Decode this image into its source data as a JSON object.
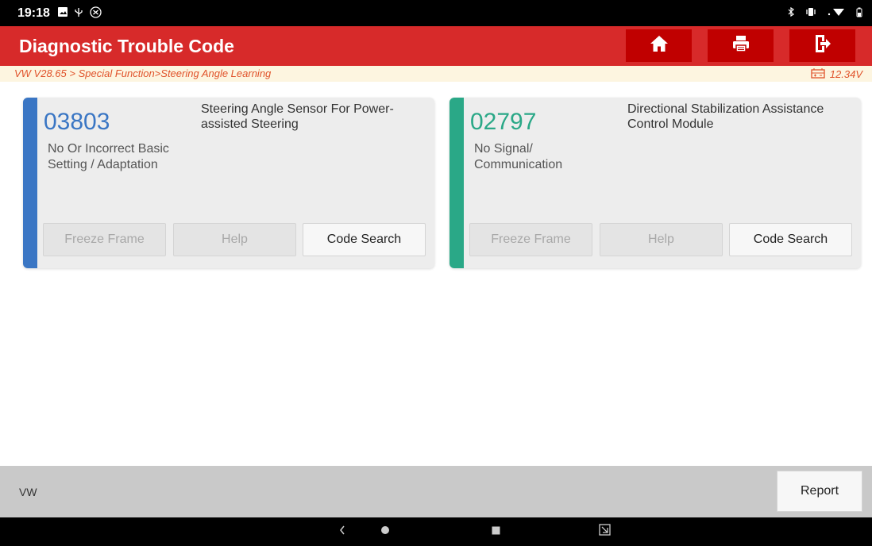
{
  "status_bar": {
    "time": "19:18",
    "left_icons": [
      "image-icon",
      "usb-icon",
      "accessibility-icon"
    ],
    "right_icons": [
      "bluetooth-icon",
      "vibrate-icon",
      "wifi-icon",
      "battery-icon"
    ]
  },
  "header": {
    "title": "Diagnostic Trouble Code",
    "buttons": [
      "home-icon",
      "print-icon",
      "exit-icon"
    ]
  },
  "breadcrumb": {
    "path": "VW V28.65 > Special Function>Steering Angle Learning",
    "voltage": "12.34V"
  },
  "dtc_cards": [
    {
      "code": "03803",
      "description": "No Or Incorrect Basic Setting / Adaptation",
      "module": "Steering Angle Sensor For Power-assisted Steering",
      "accent_color": "#3a76c4",
      "buttons": {
        "freeze_frame": "Freeze Frame",
        "help": "Help",
        "code_search": "Code Search"
      }
    },
    {
      "code": "02797",
      "description": "No Signal/ Communication",
      "module": "Directional Stabilization Assistance Control Module",
      "accent_color": "#2aa887",
      "buttons": {
        "freeze_frame": "Freeze Frame",
        "help": "Help",
        "code_search": "Code Search"
      }
    }
  ],
  "footer": {
    "make": "VW",
    "report_label": "Report"
  },
  "colors": {
    "header_red": "#d72a2a",
    "button_red": "#c00000",
    "breadcrumb_text": "#e0522a"
  }
}
